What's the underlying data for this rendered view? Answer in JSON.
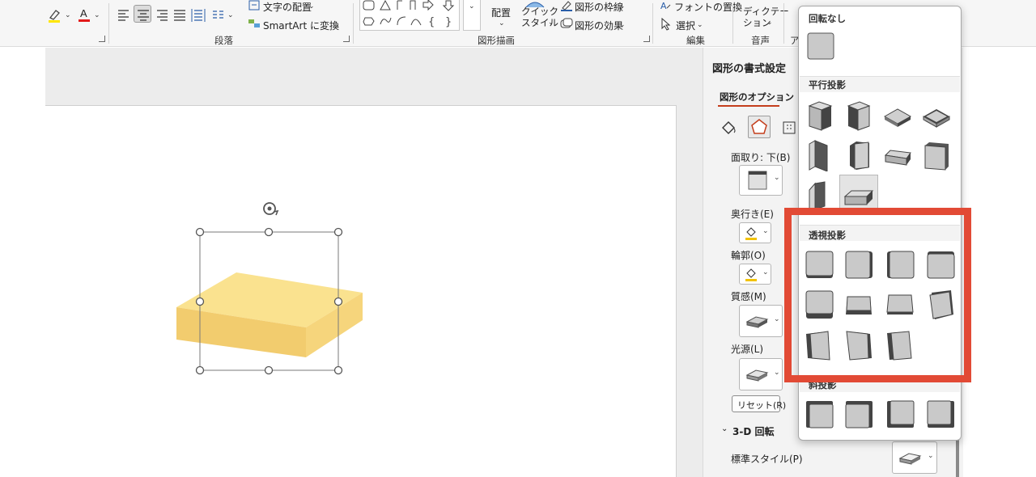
{
  "ribbon": {
    "text_layout_label": "文字の配置",
    "smartart_label": "SmartArt に変換",
    "arrange_label": "配置",
    "quick_style_label": "クイック\nスタイル",
    "shape_outline_label": "図形の枠線",
    "shape_effects_label": "図形の効果",
    "replace_font_label": "フォントの置換",
    "select_label": "選択",
    "dictate_label": "ディクテー\nション",
    "groups": {
      "paragraph": "段落",
      "drawing": "図形描画",
      "editing": "編集",
      "voice": "音声"
    },
    "overflow_glyph": "ア"
  },
  "pane": {
    "title": "図形の書式設定",
    "tab_label": "図形のオプション",
    "bevel_bottom_label": "面取り: 下(B)",
    "depth_label": "奥行き(E)",
    "contour_label": "輪郭(O)",
    "material_label": "質感(M)",
    "lighting_label": "光源(L)",
    "reset_label": "リセット(R)",
    "rotation_section_label": "3-D 回転",
    "preset_label": "標準スタイル(P)"
  },
  "popup": {
    "no_rotation_title": "回転なし",
    "parallel_title": "平行投影",
    "perspective_title": "透視投影",
    "oblique_title": "斜投影"
  },
  "colors": {
    "accent_red": "#e24a35",
    "shape_fill": "#f6d67a",
    "highlight_yellow": "#ffe600",
    "font_red": "#e21a1a"
  }
}
